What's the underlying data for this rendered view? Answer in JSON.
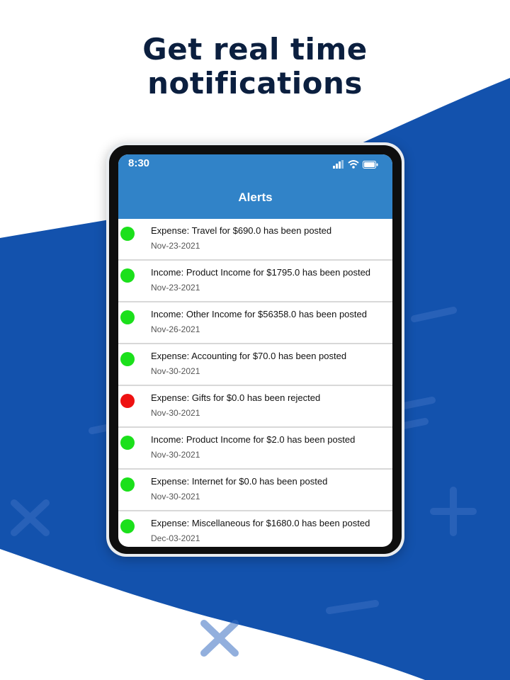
{
  "headline": {
    "line1": "Get real time",
    "line2": "notifications"
  },
  "status_bar": {
    "time": "8:30",
    "icons": [
      "signal-icon",
      "wifi-icon",
      "battery-icon"
    ]
  },
  "app": {
    "title": "Alerts"
  },
  "colors": {
    "posted": "#1be01b",
    "rejected": "#ee1111",
    "app_bar": "#3183c8",
    "brand_blue": "#1352ad",
    "headline": "#0b1f3f"
  },
  "alerts": [
    {
      "message": "Expense: Travel for $690.0 has been posted",
      "date": "Nov-23-2021",
      "status": "posted"
    },
    {
      "message": "Income: Product Income for $1795.0 has been posted",
      "date": "Nov-23-2021",
      "status": "posted"
    },
    {
      "message": "Income: Other Income for $56358.0 has been posted",
      "date": "Nov-26-2021",
      "status": "posted"
    },
    {
      "message": "Expense: Accounting for $70.0 has been posted",
      "date": "Nov-30-2021",
      "status": "posted"
    },
    {
      "message": "Expense: Gifts for $0.0 has been rejected",
      "date": "Nov-30-2021",
      "status": "rejected"
    },
    {
      "message": "Income: Product Income for $2.0 has been posted",
      "date": "Nov-30-2021",
      "status": "posted"
    },
    {
      "message": "Expense: Internet for $0.0 has been posted",
      "date": "Nov-30-2021",
      "status": "posted"
    },
    {
      "message": "Expense: Miscellaneous for $1680.0 has been posted",
      "date": "Dec-03-2021",
      "status": "posted"
    }
  ]
}
